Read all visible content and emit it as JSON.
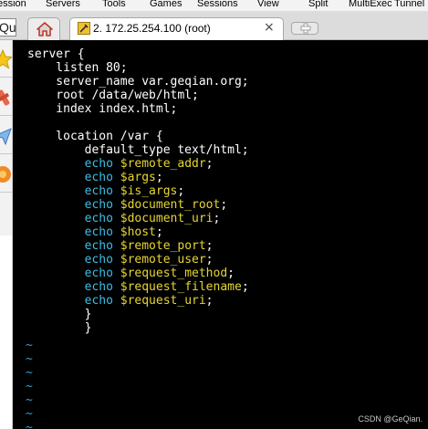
{
  "menubar": {
    "items": [
      "ession",
      "Servers",
      "Tools",
      "Games",
      "Sessions",
      "View",
      "Split",
      "MultiExec",
      "Tunnel"
    ]
  },
  "quick_connect": {
    "value": "Qu"
  },
  "tabs": {
    "session_title": "2. 172.25.254.100 (root)",
    "close_glyph": "×"
  },
  "sidebar": {
    "icons": [
      "star-icon",
      "tools-icon",
      "send-icon",
      "macro-icon"
    ]
  },
  "terminal": {
    "lines": [
      [
        {
          "t": "server {",
          "c": "white"
        }
      ],
      [
        {
          "t": "    listen 80;",
          "c": "white"
        }
      ],
      [
        {
          "t": "    server_name var.geqian.org;",
          "c": "white"
        }
      ],
      [
        {
          "t": "    root /data/web/html;",
          "c": "white"
        }
      ],
      [
        {
          "t": "    index index.html;",
          "c": "white"
        }
      ],
      [],
      [
        {
          "t": "    location /var {",
          "c": "white"
        }
      ],
      [
        {
          "t": "        default_type text/html;",
          "c": "white"
        }
      ],
      [
        {
          "t": "        echo ",
          "c": "cyan"
        },
        {
          "t": "$remote_addr",
          "c": "yellow"
        },
        {
          "t": ";",
          "c": "white"
        }
      ],
      [
        {
          "t": "        echo ",
          "c": "cyan"
        },
        {
          "t": "$args",
          "c": "yellow"
        },
        {
          "t": ";",
          "c": "white"
        }
      ],
      [
        {
          "t": "        echo ",
          "c": "cyan"
        },
        {
          "t": "$is_args",
          "c": "yellow"
        },
        {
          "t": ";",
          "c": "white"
        }
      ],
      [
        {
          "t": "        echo ",
          "c": "cyan"
        },
        {
          "t": "$document_root",
          "c": "yellow"
        },
        {
          "t": ";",
          "c": "white"
        }
      ],
      [
        {
          "t": "        echo ",
          "c": "cyan"
        },
        {
          "t": "$document_uri",
          "c": "yellow"
        },
        {
          "t": ";",
          "c": "white"
        }
      ],
      [
        {
          "t": "        echo ",
          "c": "cyan"
        },
        {
          "t": "$host",
          "c": "yellow"
        },
        {
          "t": ";",
          "c": "white"
        }
      ],
      [
        {
          "t": "        echo ",
          "c": "cyan"
        },
        {
          "t": "$remote_port",
          "c": "yellow"
        },
        {
          "t": ";",
          "c": "white"
        }
      ],
      [
        {
          "t": "        echo ",
          "c": "cyan"
        },
        {
          "t": "$remote_user",
          "c": "yellow"
        },
        {
          "t": ";",
          "c": "white"
        }
      ],
      [
        {
          "t": "        echo ",
          "c": "cyan"
        },
        {
          "t": "$request_method",
          "c": "yellow"
        },
        {
          "t": ";",
          "c": "white"
        }
      ],
      [
        {
          "t": "        echo ",
          "c": "cyan"
        },
        {
          "t": "$request_filename",
          "c": "yellow"
        },
        {
          "t": ";",
          "c": "white"
        }
      ],
      [
        {
          "t": "        echo ",
          "c": "cyan"
        },
        {
          "t": "$request_uri",
          "c": "yellow"
        },
        {
          "t": ";",
          "c": "white"
        }
      ],
      [
        {
          "t": "        }",
          "c": "white"
        }
      ],
      [
        {
          "t": "        }",
          "c": "white"
        }
      ]
    ],
    "tilde_glyph": "~",
    "tilde_count": 7,
    "colors": {
      "white": "#ffffff",
      "cyan": "#3bbfe6",
      "yellow": "#e6d632",
      "tilde": "#2aa1d8",
      "background": "#000000"
    }
  },
  "watermark": "CSDN @GeQian."
}
